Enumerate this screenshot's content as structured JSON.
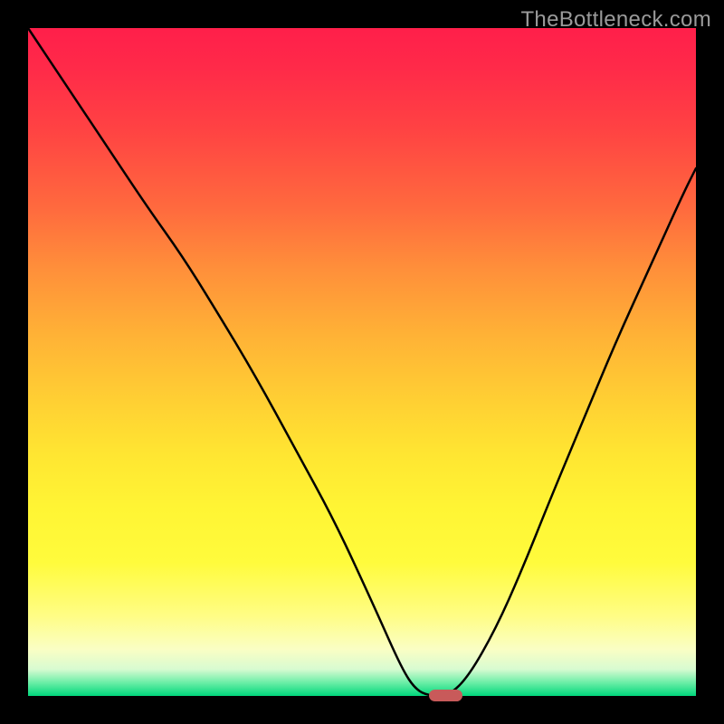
{
  "watermark": "TheBottleneck.com",
  "chart_data": {
    "type": "line",
    "title": "",
    "xlabel": "",
    "ylabel": "",
    "xlim": [
      0,
      100
    ],
    "ylim": [
      0,
      100
    ],
    "series": [
      {
        "name": "bottleneck-curve",
        "x": [
          0,
          6,
          12,
          18,
          23,
          28,
          34,
          40,
          46,
          52,
          56,
          58,
          60,
          63,
          66,
          70,
          74,
          78,
          83,
          88,
          93,
          98,
          100
        ],
        "values": [
          100,
          91,
          82,
          73,
          66,
          58,
          48,
          37,
          26,
          13,
          4,
          1,
          0,
          0,
          3,
          10,
          19,
          29,
          41,
          53,
          64,
          75,
          79
        ]
      },
      {
        "name": "optimal-marker",
        "x": [
          60,
          65
        ],
        "values": [
          0,
          0
        ]
      }
    ]
  },
  "gradient_stops": [
    {
      "pos": 0,
      "color": "#ff1f4a"
    },
    {
      "pos": 15,
      "color": "#ff4243"
    },
    {
      "pos": 36,
      "color": "#ff8f3a"
    },
    {
      "pos": 56,
      "color": "#ffd033"
    },
    {
      "pos": 80,
      "color": "#fffb3c"
    },
    {
      "pos": 96,
      "color": "#d8fbd1"
    },
    {
      "pos": 100,
      "color": "#00d77b"
    }
  ],
  "marker": {
    "color": "#c85a5a",
    "x_start": 60,
    "x_end": 65
  }
}
